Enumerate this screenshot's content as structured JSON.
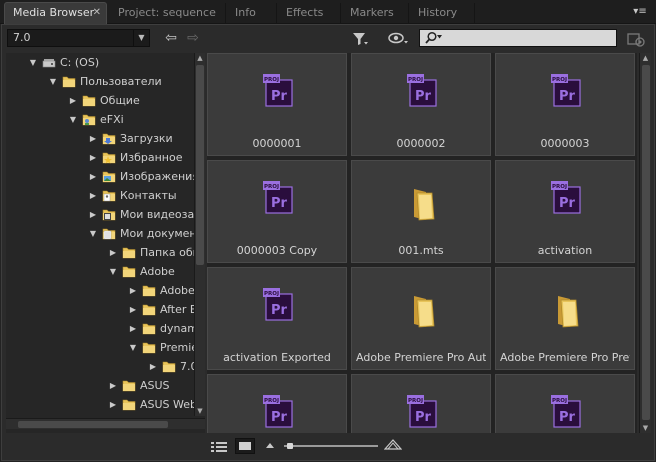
{
  "tabs": [
    {
      "label": "Media Browser",
      "active": true,
      "close": "✕"
    },
    {
      "label": "Project: sequence"
    },
    {
      "label": "Info"
    },
    {
      "label": "Effects"
    },
    {
      "label": "Markers"
    },
    {
      "label": "History"
    }
  ],
  "panel_menu": "▾≡",
  "toolbar": {
    "path_value": "7.0",
    "back_glyph": "⇦",
    "forward_glyph": "⇨"
  },
  "tree": [
    {
      "label": "C: (OS)",
      "level": 0,
      "expanded": true,
      "icon": "drive-icon"
    },
    {
      "label": "Пользователи",
      "level": 1,
      "expanded": true,
      "icon": "folder-icon"
    },
    {
      "label": "Общие",
      "level": 2,
      "expanded": false,
      "icon": "folder-icon"
    },
    {
      "label": "eFXi",
      "level": 2,
      "expanded": true,
      "icon": "user-folder-icon"
    },
    {
      "label": "Загрузки",
      "level": 3,
      "expanded": false,
      "icon": "downloads-folder-icon"
    },
    {
      "label": "Избранное",
      "level": 3,
      "expanded": false,
      "icon": "favorites-folder-icon"
    },
    {
      "label": "Изображения",
      "level": 3,
      "expanded": false,
      "icon": "pictures-folder-icon"
    },
    {
      "label": "Контакты",
      "level": 3,
      "expanded": false,
      "icon": "contacts-folder-icon"
    },
    {
      "label": "Мои видеозаписи",
      "level": 3,
      "expanded": false,
      "icon": "videos-folder-icon"
    },
    {
      "label": "Мои документы",
      "level": 3,
      "expanded": true,
      "icon": "documents-folder-icon"
    },
    {
      "label": "Папка обмена",
      "level": 4,
      "expanded": false,
      "icon": "folder-icon"
    },
    {
      "label": "Adobe",
      "level": 4,
      "expanded": true,
      "icon": "folder-icon"
    },
    {
      "label": "Adobe",
      "level": 5,
      "expanded": false,
      "icon": "folder-icon"
    },
    {
      "label": "After Effects",
      "level": 5,
      "expanded": false,
      "icon": "folder-icon"
    },
    {
      "label": "dynamiclink",
      "level": 5,
      "expanded": false,
      "icon": "folder-icon"
    },
    {
      "label": "Premiere Pro",
      "level": 5,
      "expanded": true,
      "icon": "folder-icon"
    },
    {
      "label": "7.0",
      "level": 6,
      "expanded": false,
      "icon": "folder-icon"
    },
    {
      "label": "ASUS",
      "level": 4,
      "expanded": false,
      "icon": "folder-icon"
    },
    {
      "label": "ASUS WebStorage",
      "level": 4,
      "expanded": false,
      "icon": "folder-icon"
    }
  ],
  "items": [
    {
      "name": "0000001",
      "kind": "premiere-project"
    },
    {
      "name": "0000002",
      "kind": "premiere-project"
    },
    {
      "name": "0000003",
      "kind": "premiere-project"
    },
    {
      "name": "0000003 Copy",
      "kind": "premiere-project"
    },
    {
      "name": "001.mts",
      "kind": "folder"
    },
    {
      "name": "activation",
      "kind": "premiere-project"
    },
    {
      "name": "activation Exported",
      "kind": "premiere-project"
    },
    {
      "name": "Adobe Premiere Pro Auto-Save",
      "kind": "folder"
    },
    {
      "name": "Adobe Premiere Pro Preview Files",
      "kind": "folder"
    },
    {
      "name": "",
      "kind": "premiere-project"
    },
    {
      "name": "",
      "kind": "premiere-project"
    },
    {
      "name": "",
      "kind": "premiere-project"
    }
  ],
  "icon_text": {
    "proj": "PROJ",
    "pr": "Pr"
  },
  "zoom_level": 0.03,
  "colors": {
    "pr_purple": "#9a6fe0",
    "pr_dark": "#2a0e3d",
    "folder": "#e8c45a"
  }
}
